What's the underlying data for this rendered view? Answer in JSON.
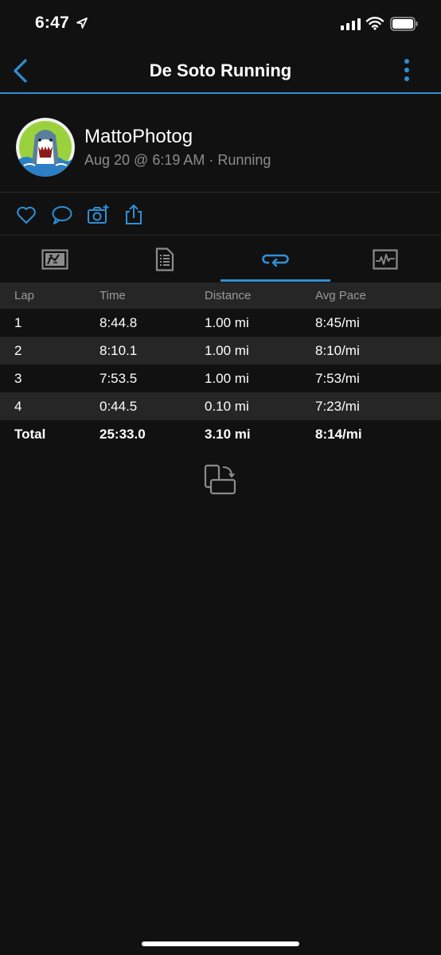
{
  "status_bar": {
    "time": "6:47"
  },
  "header": {
    "title": "De Soto Running"
  },
  "profile": {
    "user_name": "MattoPhotog",
    "meta": "Aug 20 @ 6:19 AM · Running"
  },
  "icons": {
    "back": "chevron-left-icon",
    "more": "more-vertical-icon",
    "like": "heart-icon",
    "comment": "comment-icon",
    "add_photo": "camera-plus-icon",
    "share": "share-icon",
    "tab_overview": "map-icon",
    "tab_details": "document-list-icon",
    "tab_laps": "laps-loop-icon",
    "tab_charts": "chart-icon",
    "rotate": "rotate-device-icon"
  },
  "colors": {
    "accent": "#2f8fd6",
    "background": "#111111",
    "row_alt": "#262626"
  },
  "lap_table": {
    "headers": {
      "lap": "Lap",
      "time": "Time",
      "distance": "Distance",
      "avg_pace": "Avg Pace"
    },
    "rows": [
      {
        "lap": "1",
        "time": "8:44.8",
        "distance": "1.00 mi",
        "avg_pace": "8:45/mi"
      },
      {
        "lap": "2",
        "time": "8:10.1",
        "distance": "1.00 mi",
        "avg_pace": "8:10/mi"
      },
      {
        "lap": "3",
        "time": "7:53.5",
        "distance": "1.00 mi",
        "avg_pace": "7:53/mi"
      },
      {
        "lap": "4",
        "time": "0:44.5",
        "distance": "0.10 mi",
        "avg_pace": "7:23/mi"
      }
    ],
    "total": {
      "label": "Total",
      "time": "25:33.0",
      "distance": "3.10 mi",
      "avg_pace": "8:14/mi"
    }
  }
}
